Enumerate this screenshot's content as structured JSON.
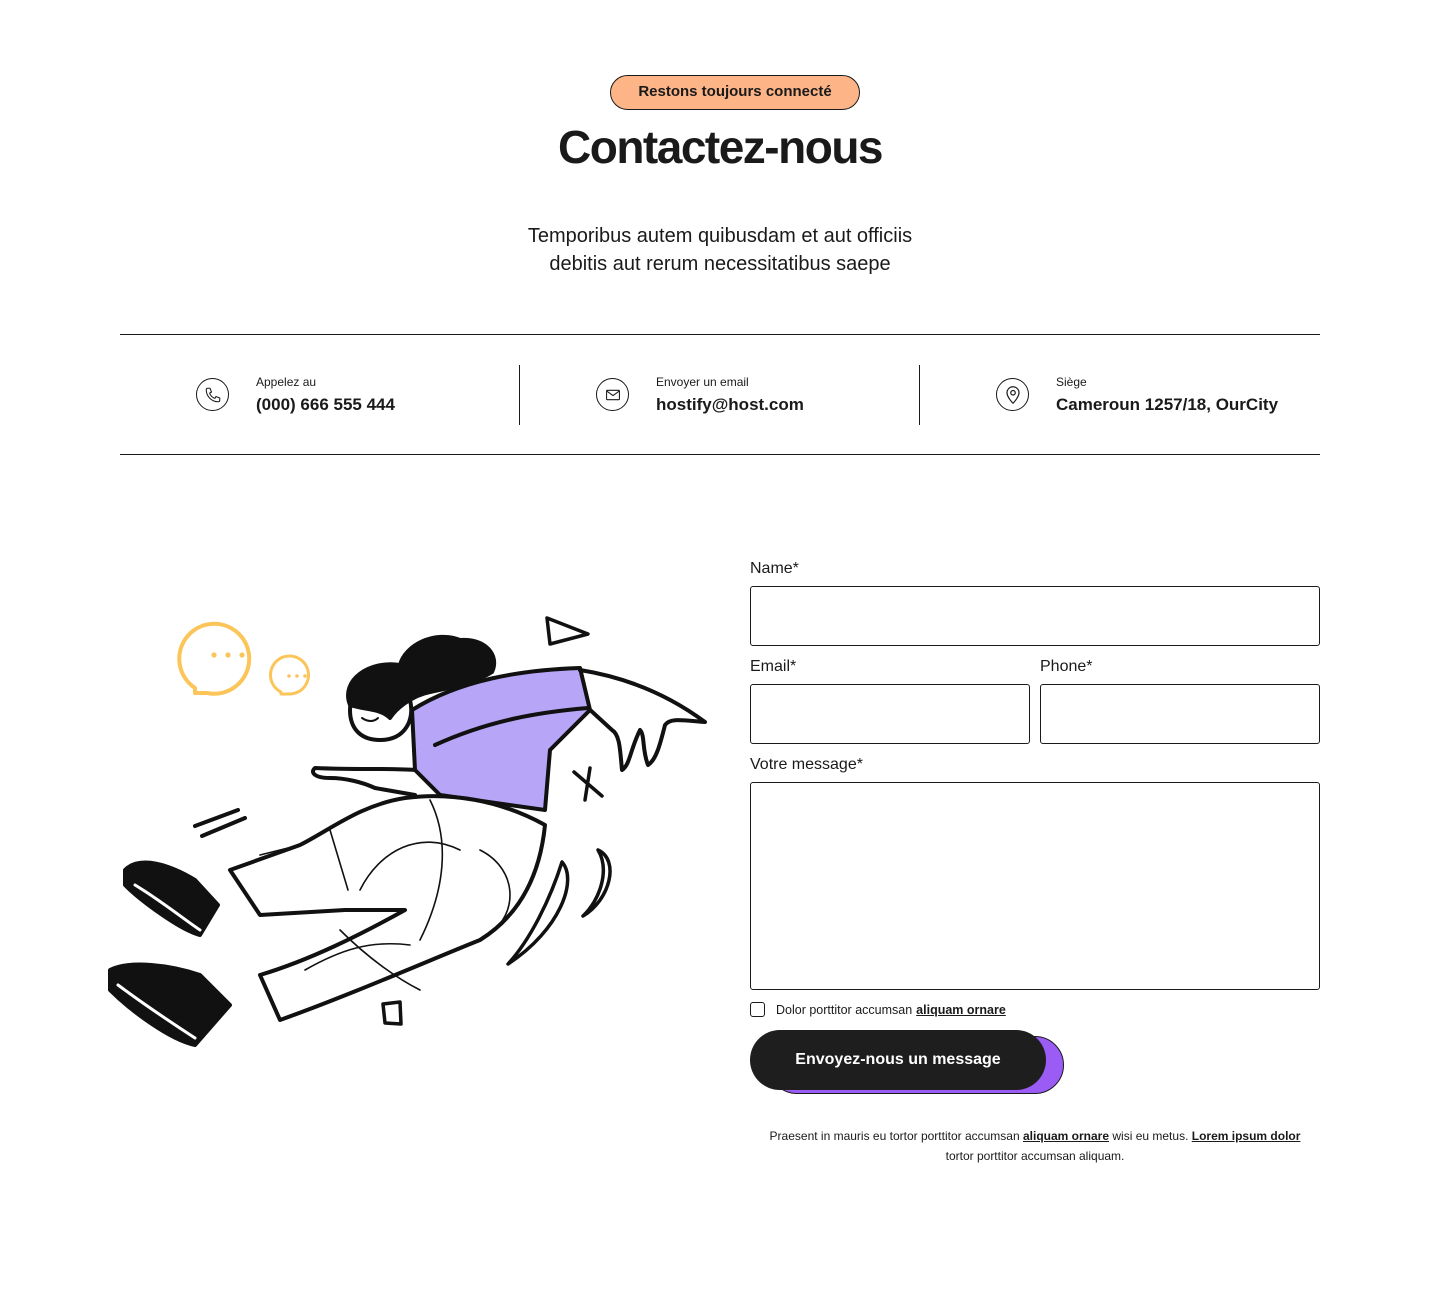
{
  "hero": {
    "badge": "Restons toujours connecté",
    "title": "Contactez-nous",
    "subtitle_line1": "Temporibus autem quibusdam et aut officiis",
    "subtitle_line2": "debitis aut rerum necessitatibus saepe"
  },
  "contact_info": [
    {
      "icon": "phone-icon",
      "label": "Appelez au",
      "value": "(000) 666 555 444"
    },
    {
      "icon": "mail-icon",
      "label": "Envoyer un email",
      "value": "hostify@host.com"
    },
    {
      "icon": "location-pin-icon",
      "label": "Siège",
      "value": "Cameroun 1257/18, OurCity"
    }
  ],
  "form": {
    "name_label": "Name*",
    "email_label": "Email*",
    "phone_label": "Phone*",
    "message_label": "Votre message*",
    "consent_text": "Dolor porttitor accumsan",
    "consent_link": "aliquam ornare",
    "submit_label": "Envoyez-nous un message"
  },
  "footnote": {
    "part1": "Praesent in mauris eu tortor porttitor accumsan",
    "link1": "aliquam ornare",
    "part2": "wisi eu metus.",
    "link2": "Lorem ipsum dolor",
    "part3": "tortor porttitor accumsan aliquam."
  },
  "colors": {
    "badge_bg": "#fdb487",
    "button_bg": "#1e1e1e",
    "button_shadow": "#9b5cf6",
    "illustration_purple": "#b7a6f7",
    "chat_bubble_yellow": "#fbc55a"
  }
}
